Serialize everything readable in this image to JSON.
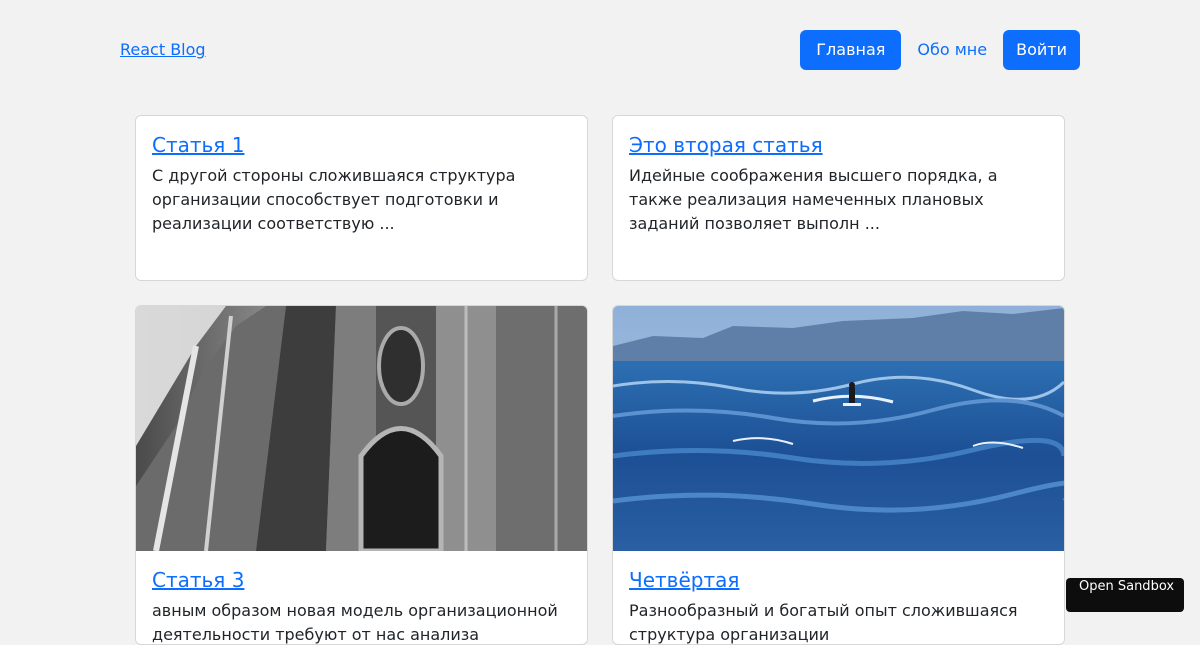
{
  "header": {
    "brand": "React Blog",
    "nav": {
      "home": "Главная",
      "about": "Обо мне",
      "login": "Войти"
    }
  },
  "posts": [
    {
      "title": "Статья 1",
      "excerpt": "С другой стороны сложившаяся структура организации способствует подготовки и реализации соответствую ..."
    },
    {
      "title": "Это вторая статья",
      "excerpt": "Идейные соображения высшего порядка, а также реализация намеченных плановых заданий позволяет выполн ..."
    },
    {
      "title": "Статья 3",
      "excerpt": "авным образом новая модель организационной деятельности требуют от нас анализа",
      "image": "architecture-photo"
    },
    {
      "title": "Четвёртая",
      "excerpt": "Разнообразный и богатый опыт сложившаяся структура организации",
      "image": "surfer-sea-photo"
    }
  ],
  "sandbox_button": "Open Sandbox",
  "colors": {
    "accent": "#0d6efd",
    "background": "#f2f2f2",
    "card": "#ffffff",
    "text": "#212529"
  }
}
